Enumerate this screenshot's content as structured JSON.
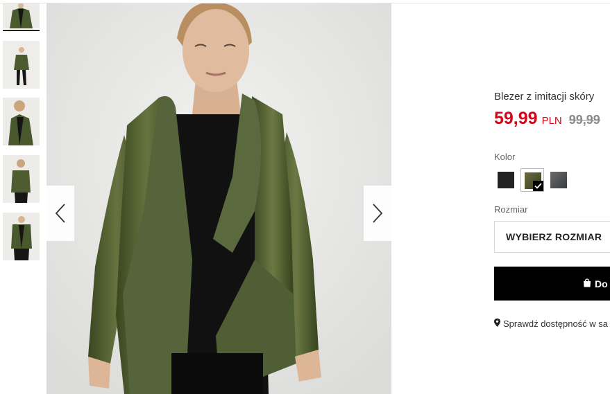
{
  "product": {
    "title": "Blezer z imitacji skóry",
    "price_current": "59,99",
    "currency": "PLN",
    "price_old": "99,99"
  },
  "color": {
    "label": "Kolor",
    "swatches": [
      {
        "name": "black",
        "hex": "#222222"
      },
      {
        "name": "olive",
        "hex": "#4a4a2a",
        "selected": true
      },
      {
        "name": "grey",
        "hex": "#555658"
      }
    ]
  },
  "size": {
    "label": "Rozmiar",
    "placeholder": "WYBIERZ ROZMIAR"
  },
  "add_to_cart": {
    "label": "Do",
    "icon": "shopping-bag-icon"
  },
  "store": {
    "label": "Sprawdź dostępność w sa",
    "icon": "location-pin-icon"
  },
  "colors": {
    "sale_red": "#d1061a",
    "jacket_olive": "#4a5a2e",
    "button_black": "#000000"
  }
}
